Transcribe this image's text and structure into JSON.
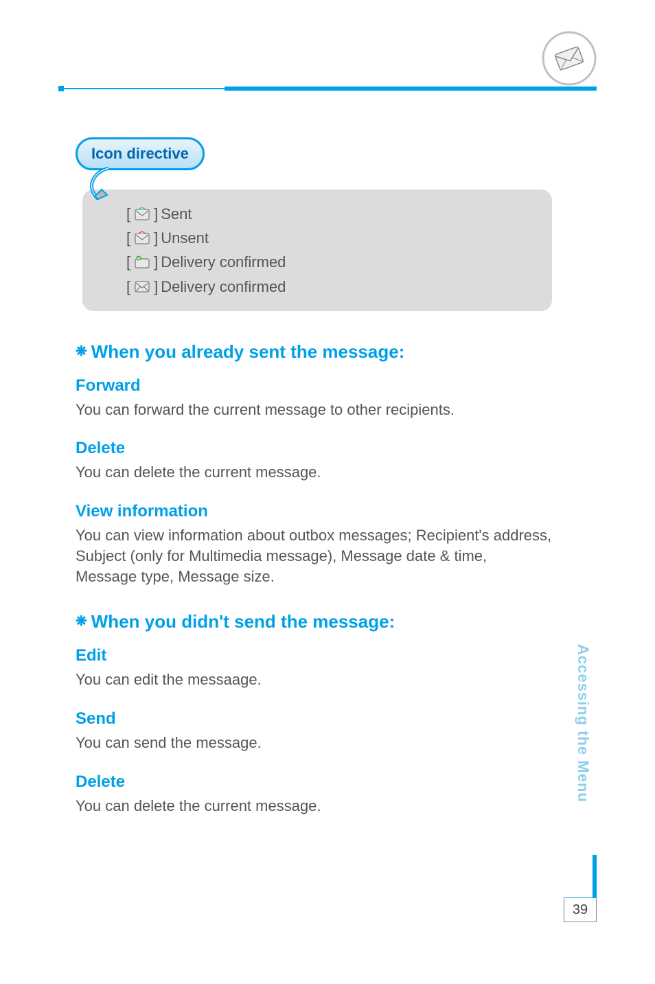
{
  "callout_label": "Icon directive",
  "icon_list": {
    "items": [
      {
        "label": "Sent"
      },
      {
        "label": "Unsent"
      },
      {
        "label": "Delivery confirmed"
      },
      {
        "label": "Delivery confirmed"
      }
    ]
  },
  "sections": [
    {
      "heading": "When you already sent the message:",
      "items": [
        {
          "title": "Forward",
          "body": "You can forward the current message to other recipients."
        },
        {
          "title": "Delete",
          "body": "You can delete the current message."
        },
        {
          "title": "View information",
          "body": "You can view information about outbox messages; Recipient's address, Subject (only for Multimedia message), Message date & time, Message type, Message size."
        }
      ]
    },
    {
      "heading": "When you didn't send the message:",
      "items": [
        {
          "title": "Edit",
          "body": "You can edit the messaage."
        },
        {
          "title": "Send",
          "body": "You can send the message."
        },
        {
          "title": "Delete",
          "body": "You can delete the current message."
        }
      ]
    }
  ],
  "side_label": "Accessing the Menu",
  "page_number": "39"
}
